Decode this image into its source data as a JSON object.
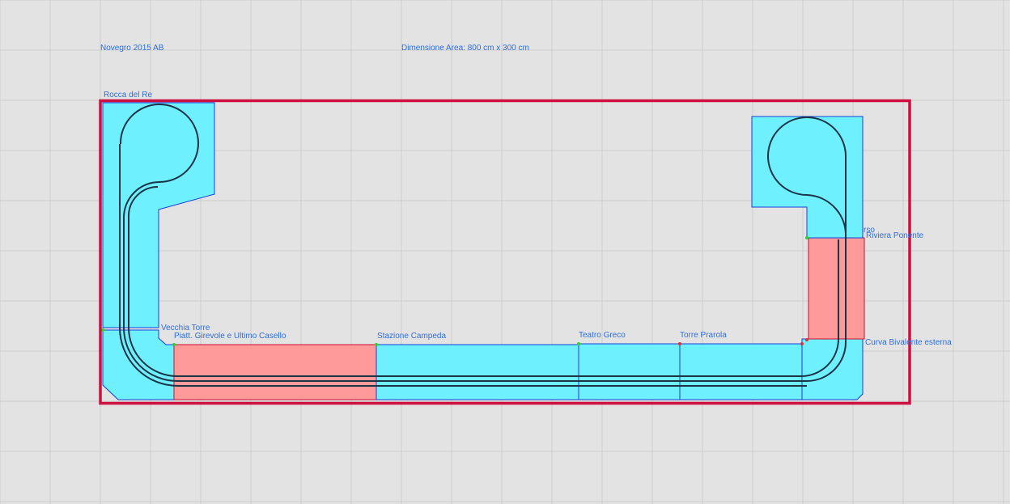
{
  "header": {
    "title": "Novegro 2015 AB",
    "area": "Dimensione Area: 800 cm x 300 cm"
  },
  "modules": {
    "rocca": "Rocca del Re",
    "vecchia": "Vecchia Torre",
    "piatt": "Piatt. Girevole e Ultimo Casello",
    "stazione": "Stazione Campeda",
    "teatro": "Teatro Greco",
    "torre": "Torre Prarola",
    "rso": "rso",
    "riviera": "Riviera Ponente",
    "curva": "Curva Bivalente esterna"
  },
  "colors": {
    "module_fill": "#6ff0ff",
    "module_border": "#1a3fd6",
    "station_fill": "#ff9a9a",
    "area_border": "#cc1040",
    "label": "#2f6fe0",
    "track": "#1b3446",
    "canvas": "#e3e3e3"
  }
}
